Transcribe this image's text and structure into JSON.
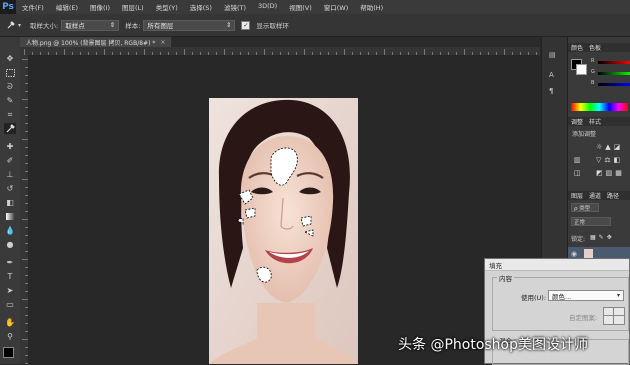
{
  "app": {
    "logo": "Ps"
  },
  "menu": [
    "文件(F)",
    "编辑(E)",
    "图像(I)",
    "图层(L)",
    "类型(Y)",
    "选择(S)",
    "滤镜(T)",
    "3D(D)",
    "视图(V)",
    "窗口(W)",
    "帮助(H)"
  ],
  "options": {
    "sample_size_label": "取样大小:",
    "sample_size_value": "取样点",
    "sample_label": "样本:",
    "sample_value": "所有图层",
    "show_ring_label": "显示取样环",
    "show_ring_checked": true
  },
  "document": {
    "tab_title": "人物.png @ 100% (背景图层 拷贝, RGB/8#) *"
  },
  "panels": {
    "color_tab": "颜色",
    "swatches_tab": "色板",
    "adjust_tab": "调整",
    "styles_tab": "样式",
    "add_adjust": "添加调整",
    "layers_tab": "图层",
    "channels_tab": "通道",
    "paths_tab": "路径",
    "kind_filter": "ρ 类型",
    "blend_mode": "正常",
    "lock_label": "锁定:",
    "channel_labels": [
      "R",
      "G",
      "B"
    ]
  },
  "fill_dialog": {
    "title": "填充",
    "contents_legend": "内容",
    "use_label": "使用(U):",
    "use_value": "颜色...",
    "custom_pattern_label": "自定图案:",
    "blend_legend": "混合"
  },
  "watermark": "头条 @Photoshop美图设计师",
  "colors": {
    "accent": "#4fa3ff",
    "foreground": "#000000",
    "background": "#ffffff"
  },
  "icons": [
    "move-icon",
    "marquee-icon",
    "lasso-icon",
    "quick-select-icon",
    "crop-icon",
    "eyedropper-icon",
    "healing-icon",
    "brush-icon",
    "stamp-icon",
    "history-brush-icon",
    "eraser-icon",
    "gradient-icon",
    "blur-icon",
    "dodge-icon",
    "pen-icon",
    "text-icon",
    "path-select-icon",
    "shape-icon",
    "hand-icon",
    "zoom-icon"
  ]
}
